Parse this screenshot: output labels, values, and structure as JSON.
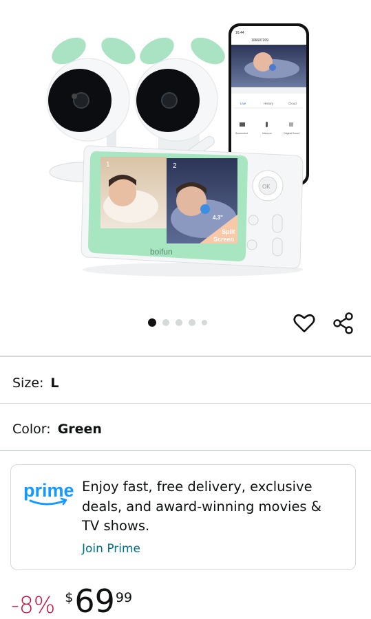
{
  "product_image": {
    "phone_time": "16:44",
    "phone_header": "106607209",
    "phone_tabs": [
      "Live",
      "History",
      "Cloud"
    ],
    "phone_actions": [
      "Screenshot",
      "Intercom",
      "Original Sound"
    ],
    "screen_labels": [
      "1",
      "2"
    ],
    "badge_size": "4.3\"",
    "badge_line1": "Split",
    "badge_line2": "Screen",
    "brand": "boifun",
    "ok_label": "OK"
  },
  "carousel": {
    "count": 5,
    "active": 0
  },
  "size": {
    "label": "Size:",
    "value": "L"
  },
  "color": {
    "label": "Color:",
    "value": "Green"
  },
  "prime": {
    "logo_text": "prime",
    "message_line1": "Enjoy fast, free delivery, exclusive",
    "message_line2": "deals, and award-winning movies &",
    "message_line3": "TV shows.",
    "link": "Join Prime"
  },
  "price": {
    "discount": "-8%",
    "symbol": "$",
    "whole": "69",
    "fraction": "99"
  },
  "colors": {
    "accent_green": "#a8e6c2",
    "link_teal": "#007185",
    "discount_red": "#cc0c39",
    "prime_blue": "#1399ff"
  }
}
